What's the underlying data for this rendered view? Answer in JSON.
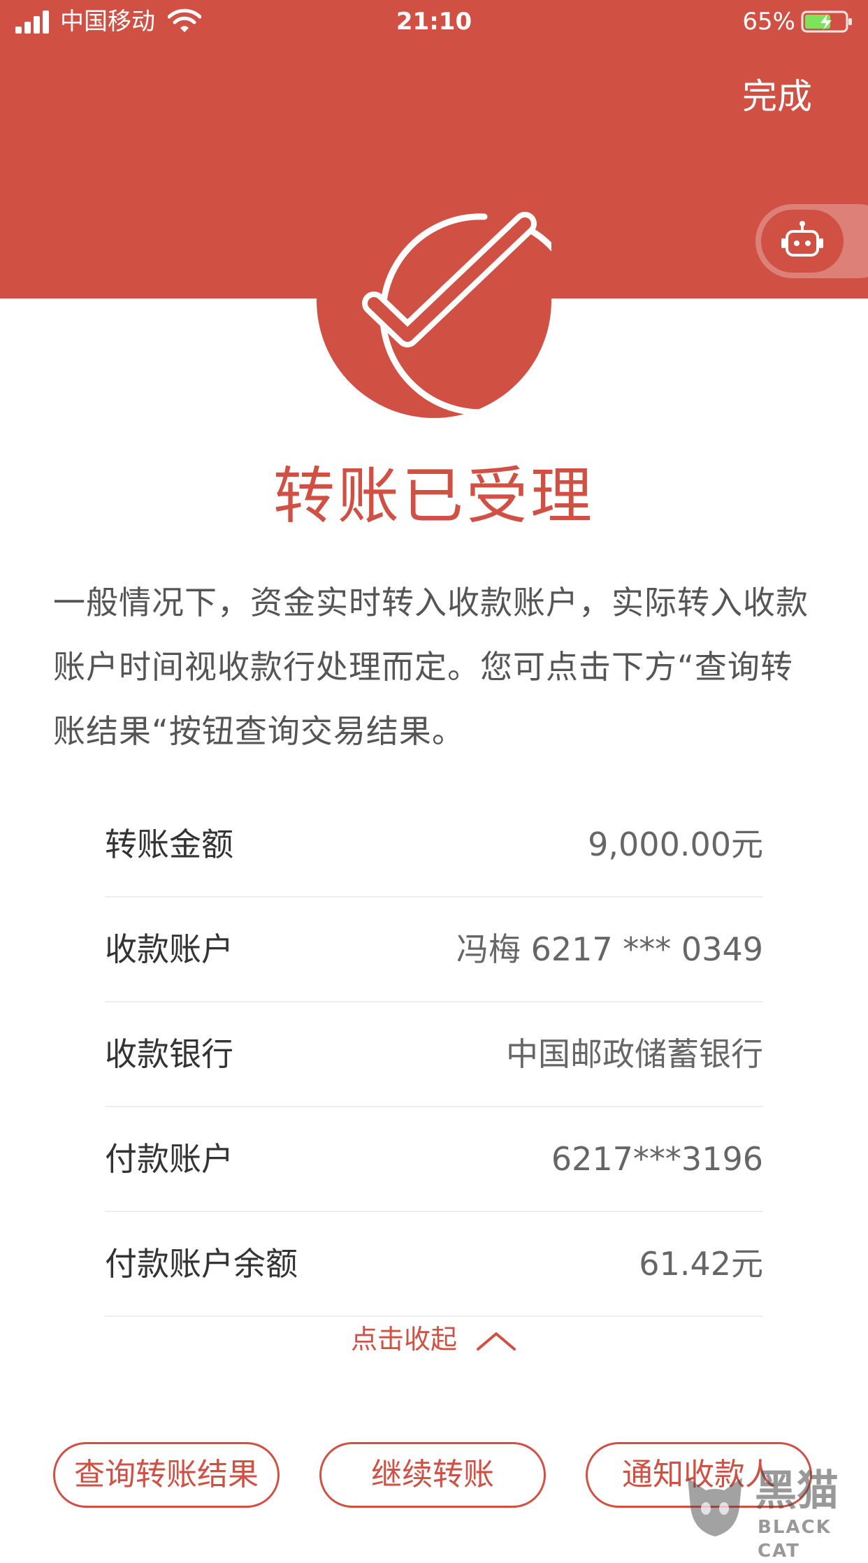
{
  "status_bar": {
    "carrier": "中国移动",
    "time": "21:10",
    "battery": "65%",
    "battery_level": 0.65
  },
  "header": {
    "done_label": "完成"
  },
  "result": {
    "title": "转账已受理",
    "description": "一般情况下，资金实时转入收款账户，实际转入收款账户时间视收款行处理而定。您可点击下方“查询转账结果“按钮查询交易结果。"
  },
  "details": [
    {
      "label": "转账金额",
      "value": "9,000.00元"
    },
    {
      "label": "收款账户",
      "value": "冯梅 6217 *** 0349"
    },
    {
      "label": "收款银行",
      "value": "中国邮政储蓄银行"
    },
    {
      "label": "付款账户",
      "value": "6217***3196"
    },
    {
      "label": "付款账户余额",
      "value": "61.42元"
    }
  ],
  "collapse_label": "点击收起",
  "actions": {
    "query_label": "查询转账结果",
    "continue_label": "继续转账",
    "notify_label": "通知收款人"
  },
  "watermark": {
    "text": "黑猫",
    "sub": "BLACK CAT"
  },
  "colors": {
    "brand": "#d05044",
    "text": "#333333",
    "secondary": "#666666"
  }
}
